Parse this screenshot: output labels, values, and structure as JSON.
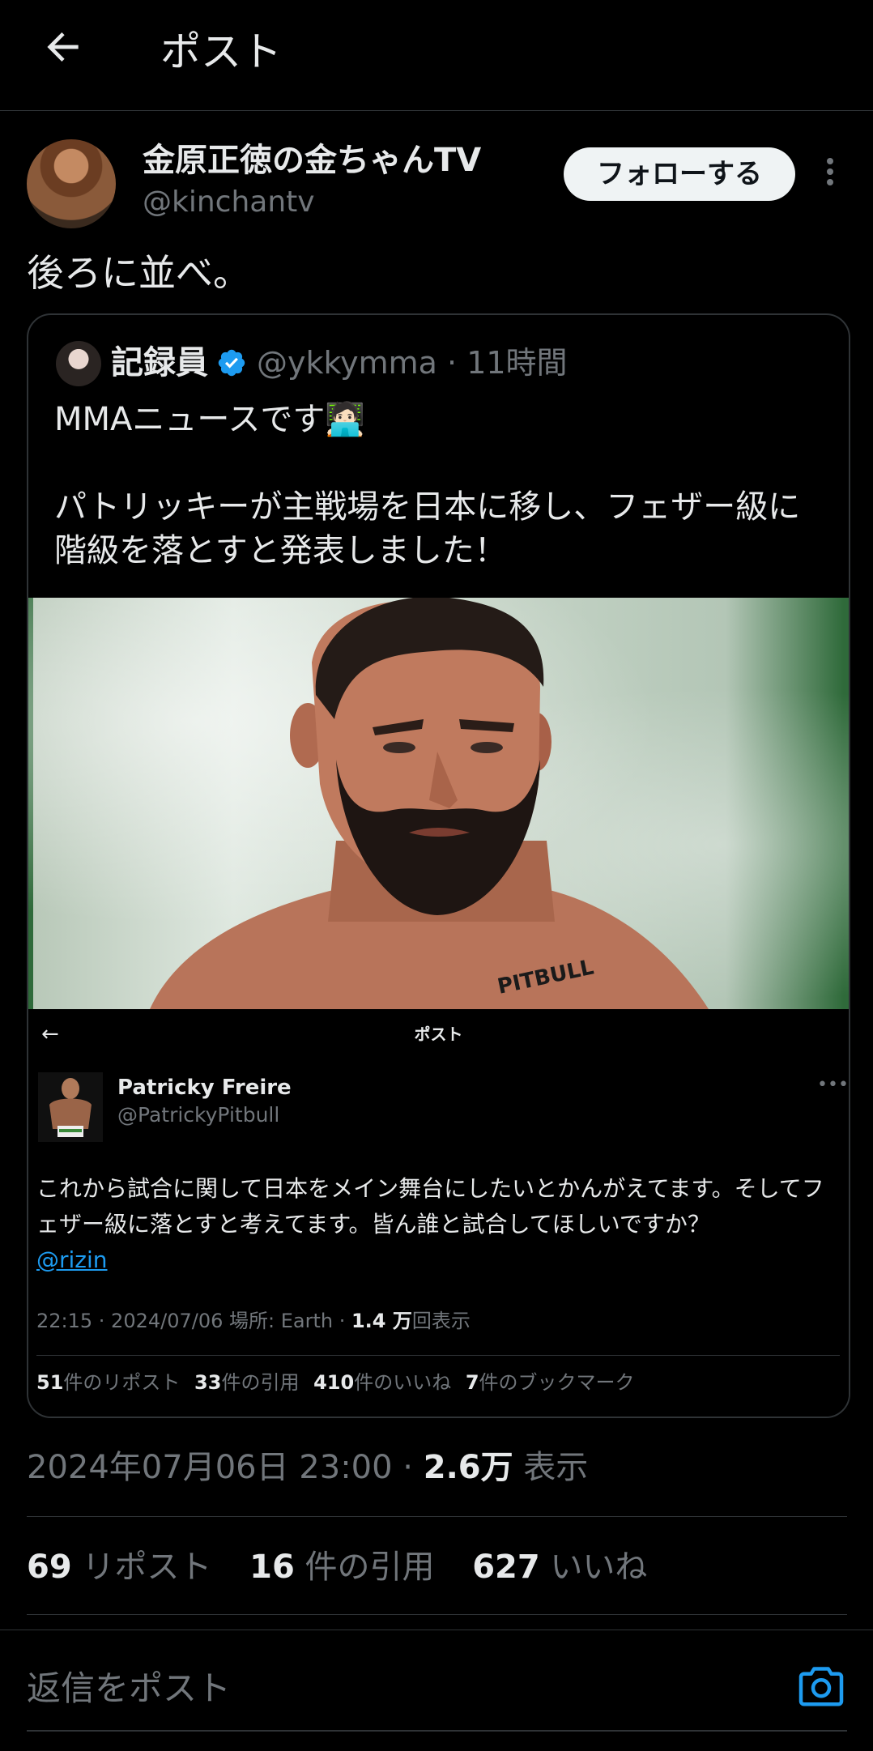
{
  "header": {
    "back_icon": "arrow-left-icon",
    "title": "ポスト"
  },
  "author": {
    "name": "金原正徳の金ちゃんTV",
    "handle": "@kinchantv",
    "follow_label": "フォローする"
  },
  "post": {
    "text": "後ろに並べ。"
  },
  "quote": {
    "name": "記録員",
    "handle": "@ykkymma · 11時間",
    "text": "MMAニュースです🧑🏻‍💻\n\nパトリッキーが主戦場を日本に移し、フェザー級に階級を落とすと発表しました！",
    "screenshot": {
      "title": "ポスト",
      "name": "Patricky Freire",
      "handle": "@PatrickyPitbull",
      "text": "これから試合に関して日本をメイン舞台にしたいとかんがえてます。そしてフェザー級に落とすと考えてます。皆ん誰と試合してほしいですか？",
      "mention": "@rizin",
      "meta_prefix": "22:15 · 2024/07/06 場所: Earth · ",
      "meta_views": "1.4 万",
      "meta_suffix": "回表示",
      "stats": [
        {
          "count": "51",
          "label": "件のリポスト"
        },
        {
          "count": "33",
          "label": "件の引用"
        },
        {
          "count": "410",
          "label": "件のいいね"
        },
        {
          "count": "7",
          "label": "件のブックマーク"
        }
      ]
    }
  },
  "meta": {
    "datetime": "2024年07月06日 23:00 · ",
    "views": "2.6万",
    "views_label": " 表示"
  },
  "stats": [
    {
      "count": "69",
      "label": " リポスト"
    },
    {
      "count": "16",
      "label": " 件の引用"
    },
    {
      "count": "627",
      "label": " いいね"
    }
  ],
  "reply": {
    "placeholder": "返信をポスト",
    "camera_icon": "camera-icon"
  },
  "colors": {
    "background": "#000000",
    "text": "#e7e9ea",
    "secondary": "#71767b",
    "accent": "#1d9bf0",
    "border": "#2f3336"
  }
}
